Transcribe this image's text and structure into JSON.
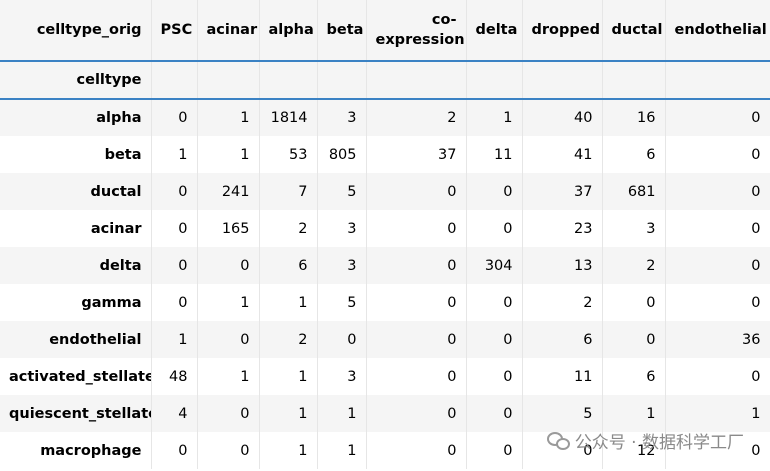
{
  "table": {
    "columns_label": "celltype_orig",
    "index_label": "celltype",
    "columns": [
      "PSC",
      "acinar",
      "alpha",
      "beta",
      "co-expression",
      "delta",
      "dropped",
      "ductal",
      "endothelial"
    ],
    "column_display": [
      "PSC",
      "acinar",
      "alpha",
      "beta",
      "co-\nexpression",
      "delta",
      "dropped",
      "ductal",
      "endothelial"
    ],
    "rows": [
      {
        "label": "alpha",
        "values": [
          "0",
          "1",
          "1814",
          "3",
          "2",
          "1",
          "40",
          "16",
          "0"
        ]
      },
      {
        "label": "beta",
        "values": [
          "1",
          "1",
          "53",
          "805",
          "37",
          "11",
          "41",
          "6",
          "0"
        ]
      },
      {
        "label": "ductal",
        "values": [
          "0",
          "241",
          "7",
          "5",
          "0",
          "0",
          "37",
          "681",
          "0"
        ]
      },
      {
        "label": "acinar",
        "values": [
          "0",
          "165",
          "2",
          "3",
          "0",
          "0",
          "23",
          "3",
          "0"
        ]
      },
      {
        "label": "delta",
        "values": [
          "0",
          "0",
          "6",
          "3",
          "0",
          "304",
          "13",
          "2",
          "0"
        ]
      },
      {
        "label": "gamma",
        "values": [
          "0",
          "1",
          "1",
          "5",
          "0",
          "0",
          "2",
          "0",
          "0"
        ]
      },
      {
        "label": "endothelial",
        "values": [
          "1",
          "0",
          "2",
          "0",
          "0",
          "0",
          "6",
          "0",
          "36"
        ]
      },
      {
        "label": "activated_stellate",
        "values": [
          "48",
          "1",
          "1",
          "3",
          "0",
          "0",
          "11",
          "6",
          "0"
        ]
      },
      {
        "label": "quiescent_stellate",
        "values": [
          "4",
          "0",
          "1",
          "1",
          "0",
          "0",
          "5",
          "1",
          "1"
        ]
      },
      {
        "label": "macrophage",
        "values": [
          "0",
          "0",
          "1",
          "1",
          "0",
          "0",
          "0",
          "12",
          "0"
        ]
      }
    ]
  },
  "watermark": {
    "icon": "wechat-icon",
    "text": "公众号 · 数据科学工厂"
  }
}
